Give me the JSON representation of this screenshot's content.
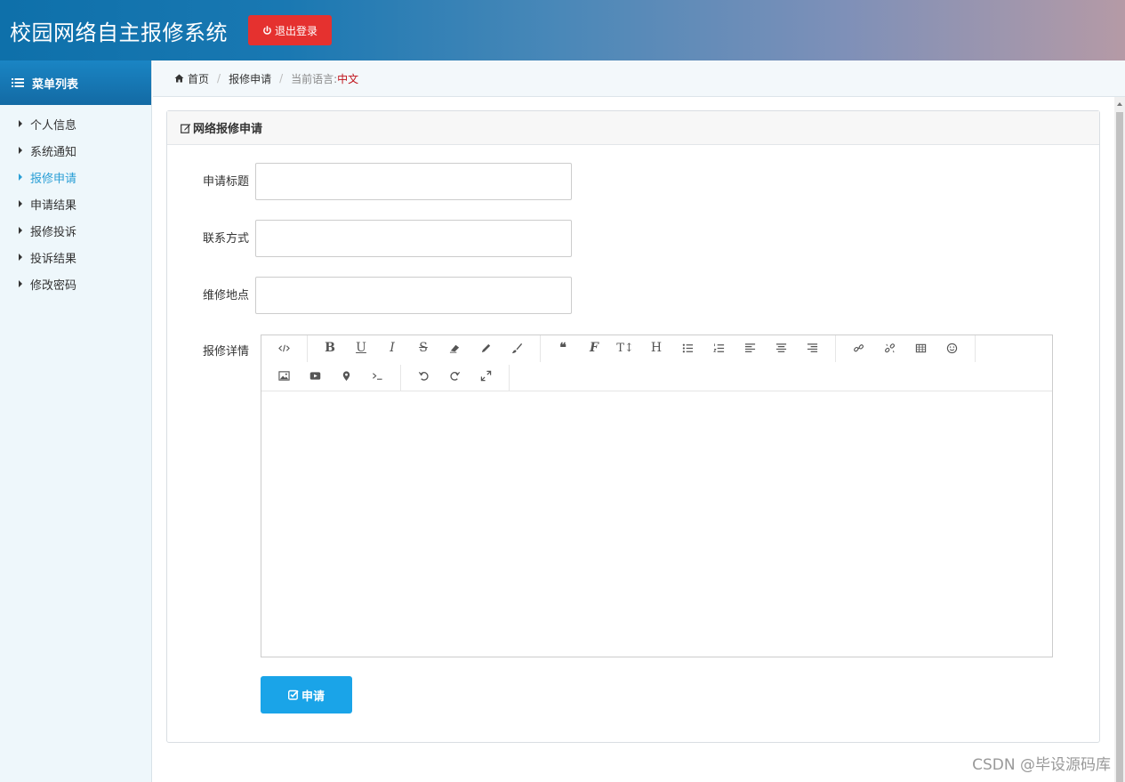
{
  "header": {
    "title": "校园网络自主报修系统",
    "logout_label": "退出登录"
  },
  "sidebar": {
    "heading": "菜单列表",
    "items": [
      {
        "label": "个人信息",
        "active": false
      },
      {
        "label": "系统通知",
        "active": false
      },
      {
        "label": "报修申请",
        "active": true
      },
      {
        "label": "申请结果",
        "active": false
      },
      {
        "label": "报修投诉",
        "active": false
      },
      {
        "label": "投诉结果",
        "active": false
      },
      {
        "label": "修改密码",
        "active": false
      }
    ]
  },
  "breadcrumb": {
    "home": "首页",
    "current": "报修申请",
    "lang_label": "当前语言:",
    "lang_value": "中文"
  },
  "panel": {
    "title": "网络报修申请",
    "fields": [
      {
        "label": "申请标题",
        "value": ""
      },
      {
        "label": "联系方式",
        "value": ""
      },
      {
        "label": "维修地点",
        "value": ""
      }
    ],
    "details_label": "报修详情",
    "submit_label": "申请"
  },
  "toolbar_icons": [
    "code-icon",
    "bold-icon",
    "underline-icon",
    "italic-icon",
    "strikethrough-icon",
    "eraser-icon",
    "pencil-icon",
    "paint-brush-icon",
    "quote-icon",
    "font-icon",
    "text-height-icon",
    "heading-icon",
    "bullet-list-icon",
    "numbered-list-icon",
    "align-left-icon",
    "align-center-icon",
    "align-right-icon",
    "link-icon",
    "unlink-icon",
    "table-icon",
    "emoji-icon",
    "image-icon",
    "video-icon",
    "map-marker-icon",
    "terminal-icon",
    "undo-icon",
    "redo-icon",
    "fullscreen-icon"
  ],
  "colors": {
    "header_start": "#0e70aa",
    "logout": "#e5312f",
    "submit": "#1aa4e8",
    "active_menu": "#2a9fd6",
    "lang": "#c0121a"
  },
  "watermark": "CSDN @毕设源码库"
}
